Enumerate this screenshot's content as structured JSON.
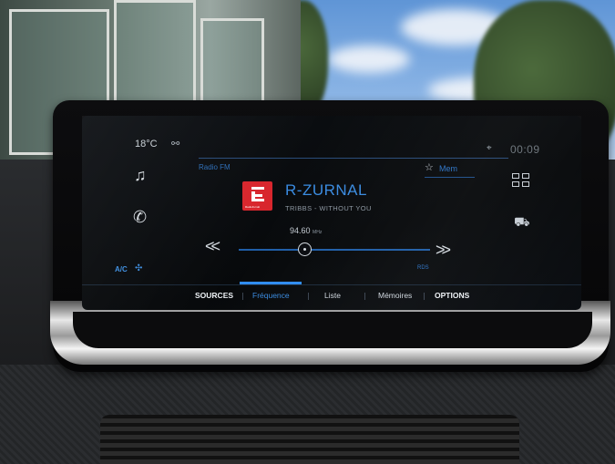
{
  "status": {
    "temperature": "18°C",
    "clock": "00:09"
  },
  "header": {
    "source_label": "Radio FM",
    "favorites_label": "Mem"
  },
  "station": {
    "name": "R-ZURNAL",
    "now_playing": "TRIBBS - WITHOUT YOU",
    "logo_text": "Radiožurnál"
  },
  "tuner": {
    "frequency": "94.60",
    "unit": "MHz",
    "band": "RDS"
  },
  "climate": {
    "ac_label": "A/C"
  },
  "tabs": [
    {
      "label": "SOURCES"
    },
    {
      "label": "Fréquence"
    },
    {
      "label": "Liste"
    },
    {
      "label": "Mémoires"
    },
    {
      "label": "OPTIONS"
    }
  ],
  "colors": {
    "accent": "#3a8be0",
    "logo_red": "#d8262d"
  },
  "icons": [
    "music-icon",
    "phone-icon",
    "apps-grid-icon",
    "car-icon",
    "star-icon",
    "location-icon",
    "wifi-icon",
    "fan-icon"
  ]
}
